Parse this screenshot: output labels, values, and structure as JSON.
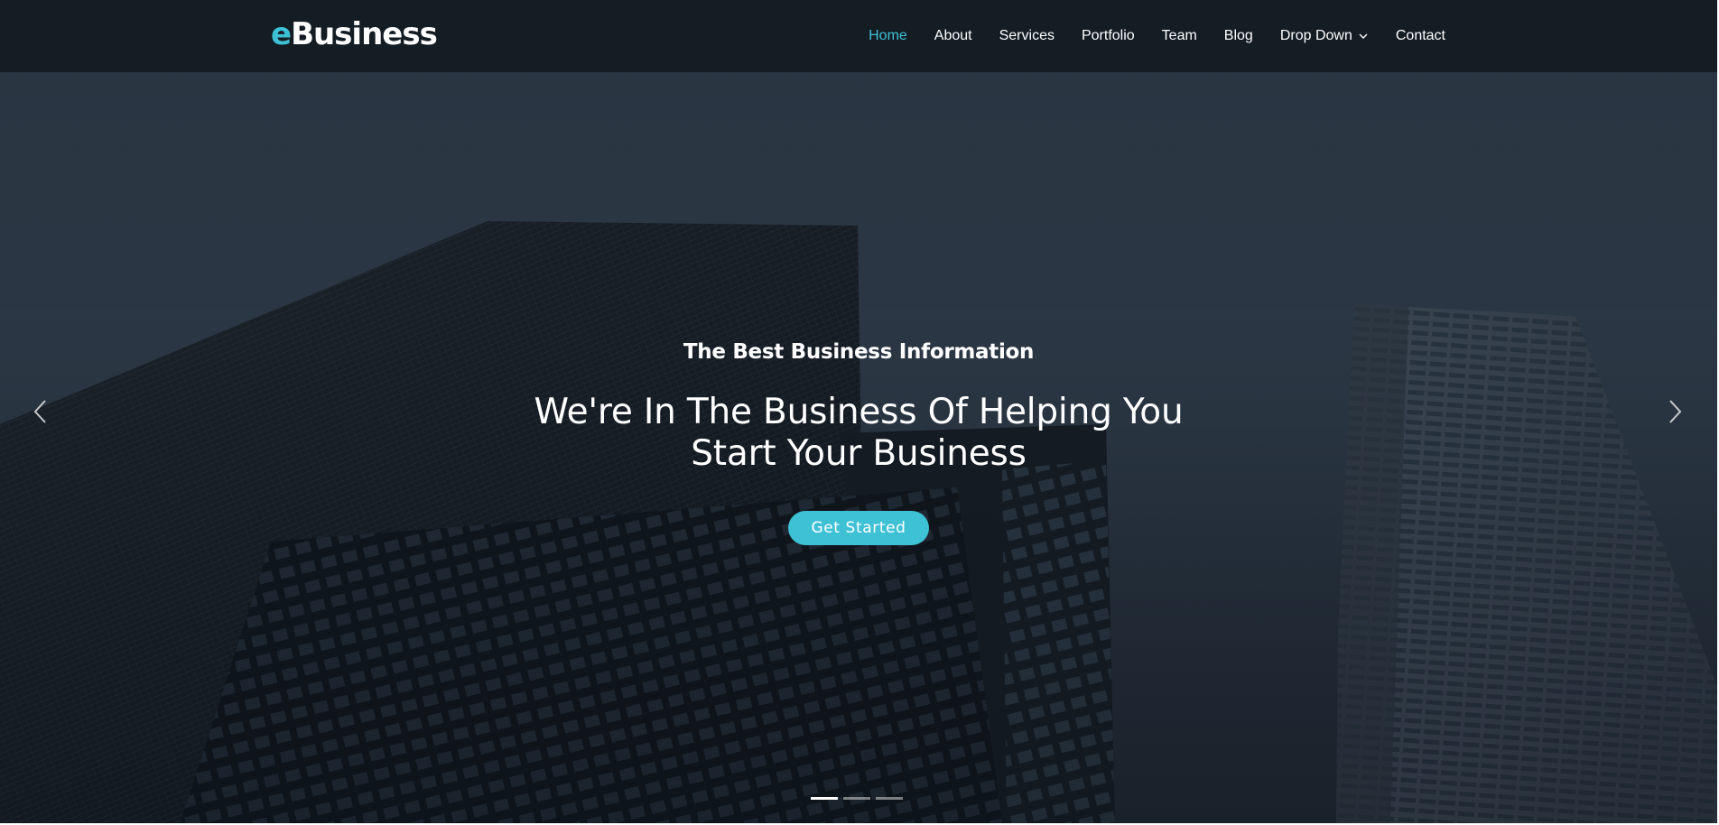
{
  "header": {
    "logo_accent": "e",
    "logo_rest": "Business"
  },
  "nav": {
    "items": [
      {
        "label": "Home",
        "active": true
      },
      {
        "label": "About"
      },
      {
        "label": "Services"
      },
      {
        "label": "Portfolio"
      },
      {
        "label": "Team"
      },
      {
        "label": "Blog"
      },
      {
        "label": "Drop Down",
        "has_dropdown": true
      },
      {
        "label": "Contact"
      }
    ]
  },
  "hero": {
    "kicker": "The Best Business Information",
    "headline": "We're In The Business Of Helping You Start Your Business",
    "cta_label": "Get Started",
    "slides_total": 3,
    "active_slide": 1
  },
  "icons": {
    "prev": "chevron-left-icon",
    "next": "chevron-right-icon",
    "dropdown": "chevron-down-icon"
  },
  "colors": {
    "accent": "#3ec1d5",
    "header_bg": "#12181f",
    "text": "#ffffff"
  }
}
